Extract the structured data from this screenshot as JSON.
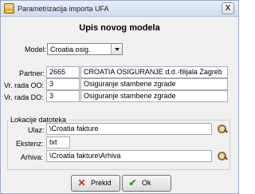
{
  "window": {
    "title": "Parametrizacija importa UFA",
    "close_glyph": "X"
  },
  "heading": "Upis novog modela",
  "form": {
    "model_label": "Model:",
    "model_value": "Croatia osig.",
    "partner_label": "Partner:",
    "partner_code": "2665",
    "partner_name": "CROATIA OSIGURANJE d.d.-filijala Zagreb",
    "vr_od_label": "Vr. rada OO:",
    "vr_od_code": "3",
    "vr_od_name": "Osiguranje stambene zgrade",
    "vr_do_label": "Vr. rada DO:",
    "vr_do_code": "3",
    "vr_do_name": "Osiguranje stambene zgrade"
  },
  "files": {
    "group_title": "Lokacije datoteka",
    "ulaz_label": "Ulaz:",
    "ulaz_value": "\\Croatia fakture",
    "ekstenz_label": "Ekstenz:",
    "ekstenz_value": "txt",
    "arhiva_label": "Arhiva:",
    "arhiva_value": "\\Croatia fakture\\Arhiva"
  },
  "buttons": {
    "cancel_label": "Prekid",
    "cancel_glyph": "✕",
    "ok_label": "Ok",
    "ok_glyph": "✔"
  },
  "colors": {
    "cancel_icon": "#c0282d",
    "ok_icon": "#2f9a2f"
  }
}
